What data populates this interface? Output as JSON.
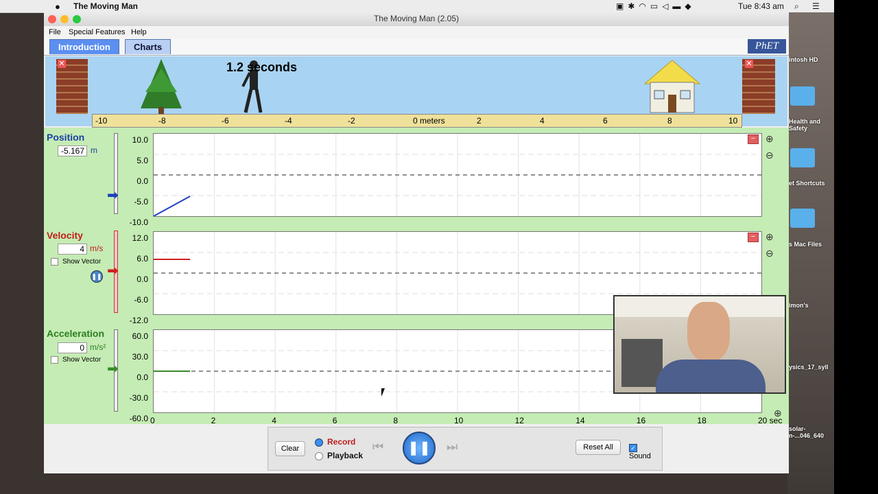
{
  "os": {
    "app_name": "The Moving Man",
    "clock": "Tue 8:43 am"
  },
  "desktop": [
    "intosh HD",
    "Health and Safety",
    "et Shortcuts",
    "s Mac Files",
    "imon's",
    "ysics_17_syll",
    "solar-\nn-...046_640"
  ],
  "window": {
    "title": "The Moving Man (2.05)"
  },
  "menu": {
    "file": "File",
    "special": "Special Features",
    "help": "Help"
  },
  "tabs": {
    "intro": "Introduction",
    "charts": "Charts",
    "logo": "PhET"
  },
  "scene": {
    "time_text": "1.2 seconds"
  },
  "ruler": {
    "ticks": [
      "-10",
      "-8",
      "-6",
      "-4",
      "-2",
      "0 meters",
      "2",
      "4",
      "6",
      "8",
      "10"
    ]
  },
  "charts": {
    "position": {
      "label": "Position",
      "value": "-5.167",
      "unit": "m",
      "yticks": [
        "10.0",
        "5.0",
        "0.0",
        "-5.0",
        "-10.0"
      ],
      "ymin": -10,
      "ymax": 10
    },
    "velocity": {
      "label": "Velocity",
      "value": "4",
      "unit": "m/s",
      "show_vector": "Show Vector",
      "yticks": [
        "12.0",
        "6.0",
        "0.0",
        "-6.0",
        "-12.0"
      ],
      "ymin": -12,
      "ymax": 12
    },
    "acceleration": {
      "label": "Acceleration",
      "value": "0",
      "unit": "m/s²",
      "show_vector": "Show Vector",
      "yticks": [
        "60.0",
        "30.0",
        "0.0",
        "-30.0",
        "-60.0"
      ],
      "ymin": -60,
      "ymax": 60
    },
    "xticks": [
      "0",
      "2",
      "4",
      "6",
      "8",
      "10",
      "12",
      "14",
      "16",
      "18",
      "20 sec"
    ],
    "xmax": 20
  },
  "chart_data": [
    {
      "type": "line",
      "title": "Position",
      "ylabel": "m",
      "ylim": [
        -10,
        10
      ],
      "xlim": [
        0,
        20
      ],
      "series": [
        {
          "x": [
            0,
            1.2
          ],
          "y": [
            -10,
            -5.167
          ]
        }
      ],
      "color": "#1a3fbf"
    },
    {
      "type": "line",
      "title": "Velocity",
      "ylabel": "m/s",
      "ylim": [
        -12,
        12
      ],
      "xlim": [
        0,
        20
      ],
      "series": [
        {
          "x": [
            0,
            1.2
          ],
          "y": [
            4,
            4
          ]
        }
      ],
      "color": "#d02020"
    },
    {
      "type": "line",
      "title": "Acceleration",
      "ylabel": "m/s²",
      "ylim": [
        -60,
        60
      ],
      "xlim": [
        0,
        20
      ],
      "series": [
        {
          "x": [
            0,
            1.2
          ],
          "y": [
            0,
            0
          ]
        }
      ],
      "color": "#3a8a2a"
    }
  ],
  "controls": {
    "clear": "Clear",
    "record": "Record",
    "playback": "Playback",
    "reset": "Reset All",
    "sound": "Sound"
  }
}
